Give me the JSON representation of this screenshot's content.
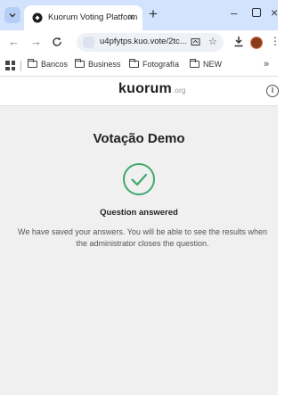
{
  "browser": {
    "tab_title": "Kuorum Voting Platform",
    "tab_close": "×",
    "new_tab": "+",
    "url": "u4pfytps.kuo.vote/2tc...",
    "bookmarks": [
      "Bancos",
      "Business",
      "Fotografía",
      "NEW"
    ],
    "bookmarks_more": "»",
    "window_controls": {
      "minimize": "–",
      "close": "×"
    }
  },
  "header": {
    "logo": "kuorum",
    "logo_suffix": ".org",
    "info": "i"
  },
  "main": {
    "title": "Votação Demo",
    "status": "Question answered",
    "message": "We have saved your answers. You will be able to see the results when the administrator closes the question."
  },
  "colors": {
    "accent": "#3fa86b",
    "page_bg": "#f0f0f0",
    "tabstrip_bg": "#d3e3fd"
  }
}
